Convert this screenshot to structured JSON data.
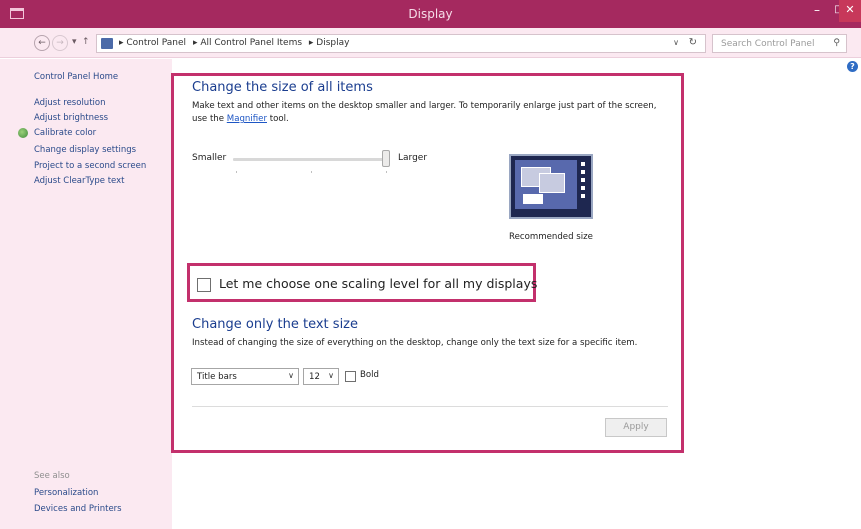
{
  "window": {
    "title": "Display",
    "minimize_glyph": "–",
    "maximize_glyph": "□",
    "close_glyph": "✕"
  },
  "address": {
    "back_glyph": "←",
    "forward_glyph": "→",
    "recent_glyph": "▾",
    "up_glyph": "↑",
    "breadcrumbs": [
      "▸ Control Panel",
      "▸ All Control Panel Items",
      "▸ Display"
    ],
    "dropdown_glyph": "∨",
    "refresh_glyph": "↻"
  },
  "search": {
    "placeholder": "Search Control Panel",
    "icon_glyph": "⚲"
  },
  "sidebar": {
    "home": "Control Panel Home",
    "items": [
      "Adjust resolution",
      "Adjust brightness",
      "Calibrate color",
      "Change display settings",
      "Project to a second screen",
      "Adjust ClearType text"
    ],
    "see_also_title": "See also",
    "see_also": [
      "Personalization",
      "Devices and Printers"
    ]
  },
  "help_glyph": "?",
  "size_section": {
    "title": "Change the size of all items",
    "description_before": "Make text and other items on the desktop smaller and larger. To temporarily enlarge just part of the screen, use the ",
    "link": "Magnifier",
    "description_after": " tool.",
    "slider_min_label": "Smaller",
    "slider_max_label": "Larger",
    "slider_value_fraction": 1.0,
    "preview_caption": "Recommended size"
  },
  "scaling_option": {
    "label": "Let me choose one scaling level for all my displays",
    "checked": false
  },
  "text_section": {
    "title": "Change only the text size",
    "description": "Instead of changing the size of everything on the desktop, change only the text size for a specific item.",
    "item_select": "Title bars",
    "size_select": "12",
    "select_arrow": "∨",
    "bold_label": "Bold",
    "bold_checked": false
  },
  "apply_label": "Apply",
  "colors": {
    "titlebar": "#a5295f",
    "highlight": "#c3306c",
    "heading": "#1a3d8f",
    "link": "#1d56c5"
  }
}
